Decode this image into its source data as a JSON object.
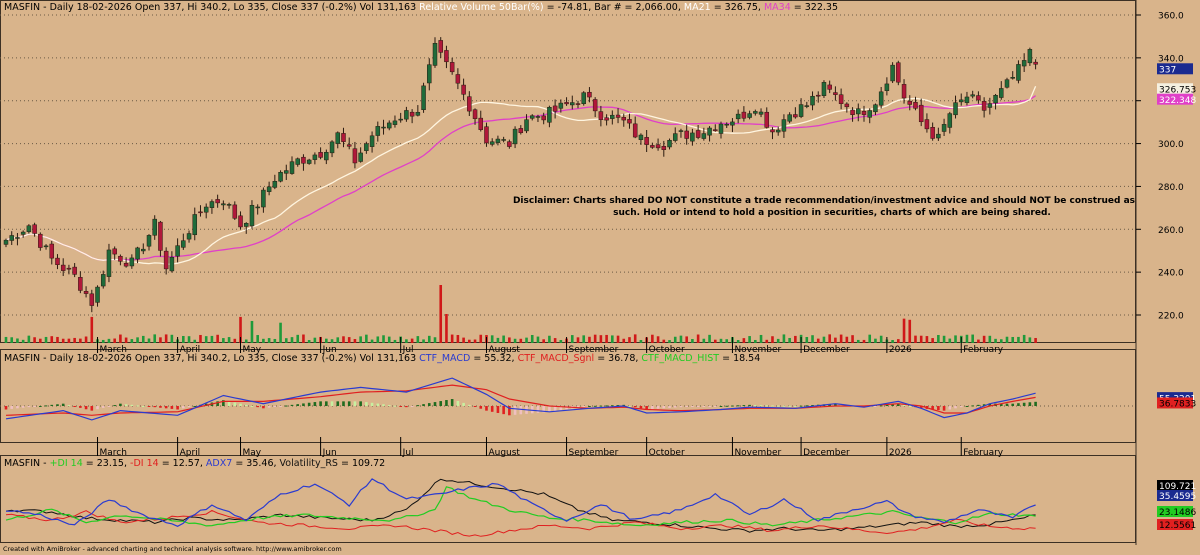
{
  "colors": {
    "background": "#D9B48B",
    "up_candle": "#1F6B3A",
    "down_candle": "#B0183A",
    "ma21": "#FFF5E0",
    "ma34": "#E040C8",
    "macd": "#2A3BD0",
    "macd_signal": "#E02020",
    "plus_di": "#22CC22",
    "minus_di": "#E02020",
    "adx": "#2A3BD0",
    "volatility": "#111111",
    "grid": "#6B5A45"
  },
  "panes": {
    "price": {
      "header": [
        {
          "text": "MASFIN - Daily 18-02-2026 Open 337, Hi 340.2, Lo 335, Close 337 (-0.2%) Vol 131,163 ",
          "color": "#000000"
        },
        {
          "text": "Relative Volume 50Bar(%)",
          "color": "#FFFFFF"
        },
        {
          "text": " = -74.81, Bar # = 2,066.00, ",
          "color": "#000000"
        },
        {
          "text": "MA21",
          "color": "#FFFFFF"
        },
        {
          "text": " = 326.75, ",
          "color": "#000000"
        },
        {
          "text": "MA34",
          "color": "#E040C8"
        },
        {
          "text": " = 322.35",
          "color": "#000000"
        }
      ],
      "y_ticks": [
        "360.0",
        "340.0",
        "320.0",
        "300.0",
        "280.0",
        "260.0",
        "240.0",
        "220.0"
      ],
      "y_tick_values": [
        360,
        340,
        320,
        300,
        280,
        260,
        240,
        220
      ],
      "ylim": [
        212,
        366
      ],
      "last_labels": [
        {
          "text": "337",
          "value": 337,
          "bg": "#1A2A90",
          "fg": "#FFFFFF"
        },
        {
          "text": "326.753",
          "value": 326.753,
          "bg": "#F5F0E0",
          "fg": "#000000"
        },
        {
          "text": "322.348",
          "value": 322.348,
          "bg": "#E040C8",
          "fg": "#FFFFFF"
        }
      ],
      "disclaimer": [
        "Disclaimer:  Charts shared DO NOT constitute a trade recommendation/investment advice and should NOT be construed as",
        "such. Hold or intend to hold a position in securities, charts of which are being shared."
      ]
    },
    "macd": {
      "header": [
        {
          "text": "MASFIN - Daily 18-02-2026 Open 337, Hi 340.2, Lo 335, Close 337 (-0.2%) Vol 131,163 ",
          "color": "#000000"
        },
        {
          "text": "CTF_MACD",
          "color": "#2A3BD0"
        },
        {
          "text": " = 55.32, ",
          "color": "#000000"
        },
        {
          "text": "CTF_MACD_Sgnl",
          "color": "#E02020"
        },
        {
          "text": " = 36.78, ",
          "color": "#000000"
        },
        {
          "text": "CTF_MACD_HIST",
          "color": "#22CC22"
        },
        {
          "text": " = 18.54",
          "color": "#000000"
        }
      ],
      "last_labels": [
        {
          "text": "55.3201",
          "bg": "#1A2A90",
          "fg": "#FFFFFF"
        },
        {
          "text": "36.7833",
          "bg": "#E02020",
          "fg": "#000000"
        }
      ]
    },
    "dmi": {
      "header": [
        {
          "text": "MASFIN - ",
          "color": "#000000"
        },
        {
          "text": "+DI 14",
          "color": "#22CC22"
        },
        {
          "text": " = 23.15, ",
          "color": "#000000"
        },
        {
          "text": "-DI 14",
          "color": "#E02020"
        },
        {
          "text": " = 12.57, ",
          "color": "#000000"
        },
        {
          "text": "ADX7",
          "color": "#2A3BD0"
        },
        {
          "text": " = 35.46, ",
          "color": "#000000"
        },
        {
          "text": "Volatility_RS",
          "color": "#111111"
        },
        {
          "text": " = 109.72",
          "color": "#000000"
        }
      ],
      "last_labels": [
        {
          "text": "109.721",
          "bg": "#000000",
          "fg": "#FFFFFF"
        },
        {
          "text": "35.4595",
          "bg": "#1A2A90",
          "fg": "#FFFFFF"
        },
        {
          "text": "23.1486",
          "bg": "#22CC22",
          "fg": "#000000"
        },
        {
          "text": "12.5561",
          "bg": "#E02020",
          "fg": "#000000"
        }
      ]
    }
  },
  "x_axis": {
    "months": [
      "March",
      "April",
      "May",
      "Jun",
      "Jul",
      "August",
      "September",
      "October",
      "November",
      "December",
      "2026",
      "February"
    ],
    "month_bar_index": [
      16,
      30,
      41,
      55,
      69,
      84,
      98,
      112,
      127,
      139,
      154,
      167
    ]
  },
  "footer": "Created with AmiBroker - advanced charting and technical analysis software. http://www.amibroker.com",
  "chart_data": {
    "type": "candlestick",
    "symbol": "MASFIN",
    "date": "18-02-2026",
    "last_bar": {
      "open": 337,
      "high": 340.2,
      "low": 335,
      "close": 337,
      "change_pct": -0.2,
      "volume": 131163
    },
    "ma21": 326.75,
    "ma34": 322.35,
    "ylim": [
      212,
      366
    ],
    "bar_count": 181,
    "close_anchors": [
      [
        0,
        255
      ],
      [
        4,
        262
      ],
      [
        8,
        246
      ],
      [
        12,
        238
      ],
      [
        15,
        226
      ],
      [
        16,
        232
      ],
      [
        18,
        250
      ],
      [
        22,
        244
      ],
      [
        26,
        262
      ],
      [
        28,
        242
      ],
      [
        31,
        256
      ],
      [
        35,
        272
      ],
      [
        38,
        274
      ],
      [
        41,
        262
      ],
      [
        44,
        272
      ],
      [
        47,
        284
      ],
      [
        51,
        292
      ],
      [
        55,
        296
      ],
      [
        58,
        304
      ],
      [
        61,
        292
      ],
      [
        64,
        304
      ],
      [
        68,
        312
      ],
      [
        72,
        316
      ],
      [
        75,
        344
      ],
      [
        78,
        332
      ],
      [
        81,
        318
      ],
      [
        84,
        302
      ],
      [
        88,
        300
      ],
      [
        91,
        312
      ],
      [
        95,
        314
      ],
      [
        98,
        318
      ],
      [
        101,
        322
      ],
      [
        104,
        314
      ],
      [
        108,
        310
      ],
      [
        111,
        302
      ],
      [
        115,
        300
      ],
      [
        118,
        304
      ],
      [
        122,
        306
      ],
      [
        125,
        310
      ],
      [
        128,
        312
      ],
      [
        131,
        318
      ],
      [
        134,
        306
      ],
      [
        137,
        314
      ],
      [
        140,
        318
      ],
      [
        143,
        326
      ],
      [
        146,
        320
      ],
      [
        149,
        314
      ],
      [
        152,
        320
      ],
      [
        155,
        336
      ],
      [
        157,
        322
      ],
      [
        160,
        310
      ],
      [
        163,
        302
      ],
      [
        165,
        314
      ],
      [
        168,
        322
      ],
      [
        171,
        316
      ],
      [
        174,
        324
      ],
      [
        177,
        334
      ],
      [
        179,
        342
      ],
      [
        180,
        337
      ]
    ],
    "big_volume_bars": [
      [
        15,
        0.45
      ],
      [
        41,
        0.45
      ],
      [
        43,
        0.38
      ],
      [
        48,
        0.35
      ],
      [
        76,
        1.0
      ],
      [
        77,
        0.5
      ],
      [
        157,
        0.42
      ],
      [
        158,
        0.4
      ]
    ],
    "macd": {
      "value": 55.32,
      "signal": 36.78,
      "hist": 18.54,
      "macd_anchors": [
        [
          0,
          -55
        ],
        [
          10,
          -20
        ],
        [
          15,
          -60
        ],
        [
          20,
          -20
        ],
        [
          30,
          -40
        ],
        [
          38,
          45
        ],
        [
          45,
          10
        ],
        [
          55,
          60
        ],
        [
          62,
          80
        ],
        [
          70,
          60
        ],
        [
          78,
          120
        ],
        [
          84,
          50
        ],
        [
          88,
          -10
        ],
        [
          95,
          -25
        ],
        [
          102,
          -10
        ],
        [
          108,
          0
        ],
        [
          112,
          -30
        ],
        [
          118,
          -25
        ],
        [
          125,
          -15
        ],
        [
          130,
          -5
        ],
        [
          138,
          -10
        ],
        [
          145,
          10
        ],
        [
          150,
          -5
        ],
        [
          156,
          20
        ],
        [
          160,
          -10
        ],
        [
          164,
          -50
        ],
        [
          168,
          -30
        ],
        [
          172,
          10
        ],
        [
          176,
          30
        ],
        [
          180,
          55
        ]
      ],
      "signal_anchors": [
        [
          0,
          -40
        ],
        [
          10,
          -30
        ],
        [
          15,
          -40
        ],
        [
          20,
          -30
        ],
        [
          30,
          -25
        ],
        [
          38,
          20
        ],
        [
          45,
          20
        ],
        [
          55,
          40
        ],
        [
          62,
          60
        ],
        [
          70,
          65
        ],
        [
          78,
          90
        ],
        [
          84,
          70
        ],
        [
          88,
          30
        ],
        [
          95,
          0
        ],
        [
          102,
          -10
        ],
        [
          108,
          -5
        ],
        [
          112,
          -15
        ],
        [
          118,
          -20
        ],
        [
          125,
          -15
        ],
        [
          130,
          -10
        ],
        [
          138,
          -10
        ],
        [
          145,
          0
        ],
        [
          150,
          0
        ],
        [
          156,
          10
        ],
        [
          160,
          0
        ],
        [
          164,
          -30
        ],
        [
          168,
          -30
        ],
        [
          172,
          0
        ],
        [
          176,
          20
        ],
        [
          180,
          37
        ]
      ],
      "ylim": [
        -140,
        160
      ]
    },
    "dmi": {
      "plus_di": 23.15,
      "minus_di": 12.57,
      "adx7": 35.46,
      "volatility_rs": 109.72,
      "plus_di_anchors": [
        [
          0,
          20
        ],
        [
          8,
          30
        ],
        [
          14,
          18
        ],
        [
          20,
          25
        ],
        [
          28,
          20
        ],
        [
          36,
          15
        ],
        [
          44,
          22
        ],
        [
          52,
          25
        ],
        [
          60,
          22
        ],
        [
          68,
          20
        ],
        [
          75,
          30
        ],
        [
          77,
          52
        ],
        [
          82,
          40
        ],
        [
          88,
          30
        ],
        [
          95,
          22
        ],
        [
          102,
          20
        ],
        [
          110,
          15
        ],
        [
          118,
          18
        ],
        [
          126,
          20
        ],
        [
          134,
          15
        ],
        [
          142,
          20
        ],
        [
          150,
          25
        ],
        [
          155,
          28
        ],
        [
          160,
          22
        ],
        [
          166,
          18
        ],
        [
          172,
          26
        ],
        [
          178,
          25
        ],
        [
          180,
          23
        ]
      ],
      "minus_di_anchors": [
        [
          0,
          25
        ],
        [
          8,
          20
        ],
        [
          14,
          28
        ],
        [
          20,
          18
        ],
        [
          28,
          22
        ],
        [
          36,
          28
        ],
        [
          44,
          18
        ],
        [
          52,
          15
        ],
        [
          60,
          12
        ],
        [
          68,
          15
        ],
        [
          75,
          10
        ],
        [
          82,
          5
        ],
        [
          88,
          10
        ],
        [
          95,
          15
        ],
        [
          102,
          12
        ],
        [
          110,
          18
        ],
        [
          118,
          12
        ],
        [
          126,
          15
        ],
        [
          134,
          10
        ],
        [
          142,
          15
        ],
        [
          150,
          10
        ],
        [
          155,
          8
        ],
        [
          160,
          12
        ],
        [
          166,
          20
        ],
        [
          172,
          14
        ],
        [
          178,
          12
        ],
        [
          180,
          12.6
        ]
      ],
      "adx_anchors": [
        [
          0,
          30
        ],
        [
          6,
          25
        ],
        [
          12,
          15
        ],
        [
          18,
          40
        ],
        [
          24,
          25
        ],
        [
          30,
          15
        ],
        [
          36,
          35
        ],
        [
          42,
          20
        ],
        [
          48,
          45
        ],
        [
          54,
          55
        ],
        [
          60,
          35
        ],
        [
          64,
          60
        ],
        [
          70,
          40
        ],
        [
          76,
          45
        ],
        [
          80,
          50
        ],
        [
          86,
          55
        ],
        [
          92,
          35
        ],
        [
          98,
          20
        ],
        [
          104,
          35
        ],
        [
          110,
          20
        ],
        [
          118,
          30
        ],
        [
          124,
          45
        ],
        [
          130,
          25
        ],
        [
          136,
          40
        ],
        [
          142,
          20
        ],
        [
          148,
          30
        ],
        [
          154,
          38
        ],
        [
          158,
          25
        ],
        [
          164,
          18
        ],
        [
          170,
          30
        ],
        [
          176,
          22
        ],
        [
          180,
          35.5
        ]
      ],
      "vol_anchors": [
        [
          0,
          30
        ],
        [
          8,
          28
        ],
        [
          14,
          22
        ],
        [
          20,
          20
        ],
        [
          26,
          18
        ],
        [
          32,
          22
        ],
        [
          40,
          20
        ],
        [
          48,
          25
        ],
        [
          56,
          22
        ],
        [
          64,
          20
        ],
        [
          70,
          30
        ],
        [
          76,
          60
        ],
        [
          82,
          55
        ],
        [
          88,
          50
        ],
        [
          94,
          45
        ],
        [
          100,
          30
        ],
        [
          106,
          20
        ],
        [
          112,
          18
        ],
        [
          118,
          15
        ],
        [
          124,
          12
        ],
        [
          130,
          10
        ],
        [
          136,
          12
        ],
        [
          142,
          10
        ],
        [
          148,
          12
        ],
        [
          154,
          15
        ],
        [
          160,
          18
        ],
        [
          166,
          14
        ],
        [
          172,
          16
        ],
        [
          178,
          22
        ],
        [
          180,
          25
        ]
      ],
      "ylim": [
        0,
        75
      ]
    }
  }
}
